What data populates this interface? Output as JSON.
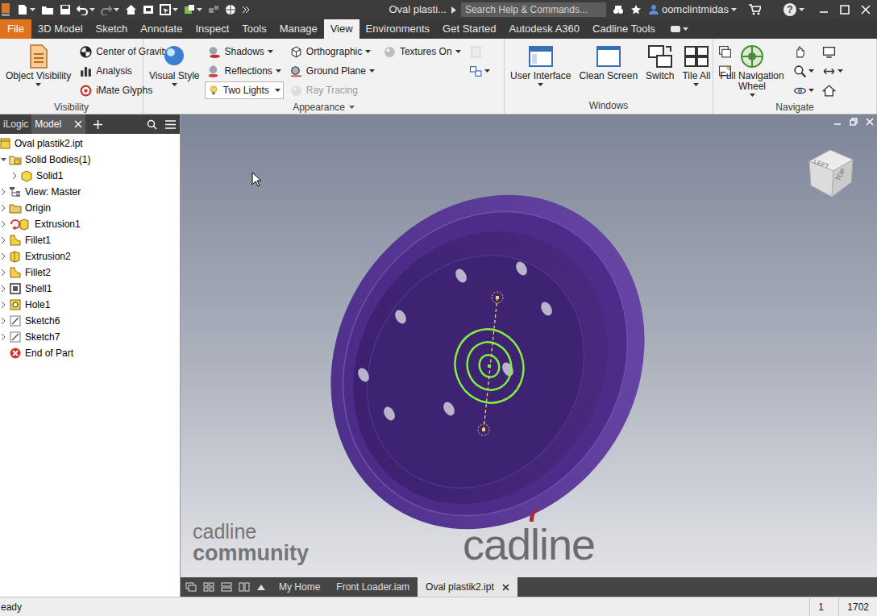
{
  "title_bar": {
    "title": "Oval plasti...",
    "search_placeholder": "Search Help & Commands...",
    "user": "oomclintmidas",
    "help": "?"
  },
  "file_tab": "File",
  "menu_tabs": [
    {
      "label": "3D Model",
      "selected": false
    },
    {
      "label": "Sketch",
      "selected": false
    },
    {
      "label": "Annotate",
      "selected": false
    },
    {
      "label": "Inspect",
      "selected": false
    },
    {
      "label": "Tools",
      "selected": false
    },
    {
      "label": "Manage",
      "selected": false
    },
    {
      "label": "View",
      "selected": true
    },
    {
      "label": "Environments",
      "selected": false
    },
    {
      "label": "Get Started",
      "selected": false
    },
    {
      "label": "Autodesk A360",
      "selected": false
    },
    {
      "label": "Cadline Tools",
      "selected": false
    }
  ],
  "ribbon": {
    "panels": [
      {
        "title": "Visibility",
        "menu": false,
        "columns": [
          [
            {
              "label": "Object Visibility",
              "kind": "large",
              "dropdown": true,
              "disabled": false
            }
          ],
          [
            {
              "label": "Center of Gravity",
              "kind": "small",
              "dropdown": false,
              "disabled": false
            },
            {
              "label": "Analysis",
              "kind": "small",
              "dropdown": false,
              "disabled": false
            },
            {
              "label": "iMate Glyphs",
              "kind": "small",
              "dropdown": false,
              "disabled": false
            }
          ]
        ]
      },
      {
        "title": "Appearance",
        "menu": true,
        "columns": [
          [
            {
              "label": "Visual Style",
              "kind": "large",
              "dropdown": true,
              "disabled": false
            }
          ],
          [
            {
              "label": "Shadows",
              "kind": "small",
              "dropdown": true,
              "disabled": false
            },
            {
              "label": "Reflections",
              "kind": "small",
              "dropdown": true,
              "disabled": false
            },
            {
              "label": "Two Lights",
              "kind": "combo",
              "dropdown": true,
              "disabled": false
            }
          ],
          [
            {
              "label": "Orthographic",
              "kind": "small",
              "dropdown": true,
              "disabled": false
            },
            {
              "label": "Ground Plane",
              "kind": "small",
              "dropdown": true,
              "disabled": false
            },
            {
              "label": "Ray Tracing",
              "kind": "small",
              "dropdown": false,
              "disabled": true
            }
          ],
          [
            {
              "label": "Textures On",
              "kind": "small",
              "dropdown": true,
              "disabled": false
            }
          ],
          [
            {
              "kind": "icon",
              "dropdown": false,
              "disabled": true
            },
            {
              "kind": "icon",
              "dropdown": true,
              "disabled": false
            }
          ]
        ]
      },
      {
        "title": "Windows",
        "menu": false,
        "columns": [
          [
            {
              "label": "User Interface",
              "kind": "large",
              "dropdown": true,
              "disabled": false
            }
          ],
          [
            {
              "label": "Clean Screen",
              "kind": "large",
              "dropdown": false,
              "disabled": false
            }
          ],
          [
            {
              "label": "Switch",
              "kind": "large",
              "dropdown": false,
              "disabled": false
            }
          ],
          [
            {
              "label": "Tile All",
              "kind": "large",
              "dropdown": true,
              "disabled": false
            }
          ],
          [
            {
              "kind": "icon",
              "dropdown": false,
              "disabled": false
            },
            {
              "kind": "icon",
              "dropdown": false,
              "disabled": false
            }
          ]
        ]
      },
      {
        "title": "Navigate",
        "menu": false,
        "columns": [
          [
            {
              "label": "Full Navigation Wheel",
              "kind": "large",
              "dropdown": true,
              "disabled": false
            }
          ],
          [
            {
              "kind": "icon",
              "dropdown": false,
              "disabled": false
            },
            {
              "kind": "icon",
              "dropdown": true,
              "disabled": false
            },
            {
              "kind": "icon",
              "dropdown": true,
              "disabled": false
            }
          ],
          [
            {
              "kind": "icon",
              "dropdown": false,
              "disabled": false
            },
            {
              "kind": "icon",
              "dropdown": true,
              "disabled": false
            },
            {
              "kind": "icon",
              "dropdown": false,
              "disabled": false
            }
          ]
        ]
      }
    ]
  },
  "browser": {
    "tabs": [
      {
        "label": "iLogic",
        "selected": false
      },
      {
        "label": "Model",
        "selected": true
      }
    ],
    "items": [
      {
        "label": "Oval plastik2.ipt",
        "depth": 0,
        "kind": "part",
        "expandable": false,
        "expanded": false
      },
      {
        "label": "Solid Bodies(1)",
        "depth": 1,
        "kind": "solid-bodies",
        "expandable": true,
        "expanded": true
      },
      {
        "label": "Solid1",
        "depth": 2,
        "kind": "solid",
        "expandable": true,
        "expanded": false
      },
      {
        "label": "View: Master",
        "depth": 1,
        "kind": "view",
        "expandable": true,
        "expanded": false
      },
      {
        "label": "Origin",
        "depth": 1,
        "kind": "origin",
        "expandable": true,
        "expanded": false
      },
      {
        "label": "Extrusion1",
        "depth": 1,
        "kind": "extrusion-shared",
        "expandable": true,
        "expanded": false
      },
      {
        "label": "Fillet1",
        "depth": 1,
        "kind": "fillet",
        "expandable": true,
        "expanded": false
      },
      {
        "label": "Extrusion2",
        "depth": 1,
        "kind": "extrusion",
        "expandable": true,
        "expanded": false
      },
      {
        "label": "Fillet2",
        "depth": 1,
        "kind": "fillet",
        "expandable": true,
        "expanded": false
      },
      {
        "label": "Shell1",
        "depth": 1,
        "kind": "shell",
        "expandable": true,
        "expanded": false
      },
      {
        "label": "Hole1",
        "depth": 1,
        "kind": "hole",
        "expandable": true,
        "expanded": false
      },
      {
        "label": "Sketch6",
        "depth": 1,
        "kind": "sketch",
        "expandable": true,
        "expanded": false
      },
      {
        "label": "Sketch7",
        "depth": 1,
        "kind": "sketch",
        "expandable": true,
        "expanded": false
      },
      {
        "label": "End of Part",
        "depth": 1,
        "kind": "end",
        "expandable": false,
        "expanded": false
      }
    ]
  },
  "viewport": {
    "viewcube": [
      "LEFT",
      "TOP"
    ],
    "watermark": {
      "line1": "cadline",
      "line2": "community"
    },
    "logo": "cadline"
  },
  "doc_tabs": [
    {
      "label": "My Home",
      "selected": false
    },
    {
      "label": "Front Loader.iam",
      "selected": false
    },
    {
      "label": "Oval plastik2.ipt",
      "selected": true
    }
  ],
  "status_bar": {
    "left": "eady",
    "right": [
      "1",
      "1702"
    ]
  }
}
